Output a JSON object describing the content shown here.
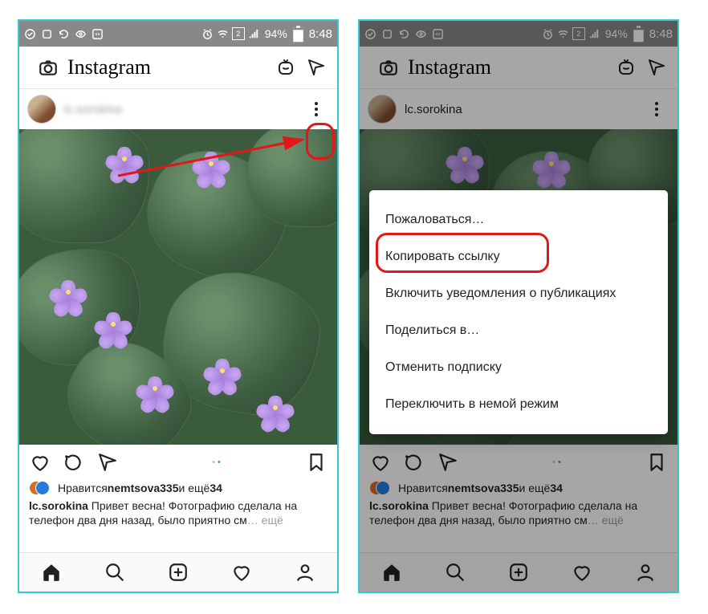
{
  "status": {
    "batteryPercent": "94%",
    "time": "8:48",
    "simLabel": "2"
  },
  "app": {
    "title": "Instagram"
  },
  "post": {
    "usernameHidden": "lc.sorokina",
    "usernameVisible": "lc.sorokina",
    "likes": {
      "prefix": "Нравится ",
      "name": "nemtsova335",
      "middle": " и ещё ",
      "count": "34"
    },
    "caption": {
      "author": "lc.sorokina",
      "text": " Привет весна! Фотографию сделала на телефон два дня назад, было приятно см",
      "more": "… ещё"
    }
  },
  "sheet": {
    "items": [
      "Пожаловаться…",
      "Копировать ссылку",
      "Включить уведомления о публикациях",
      "Поделиться в…",
      "Отменить подписку",
      "Переключить в немой режим"
    ]
  }
}
